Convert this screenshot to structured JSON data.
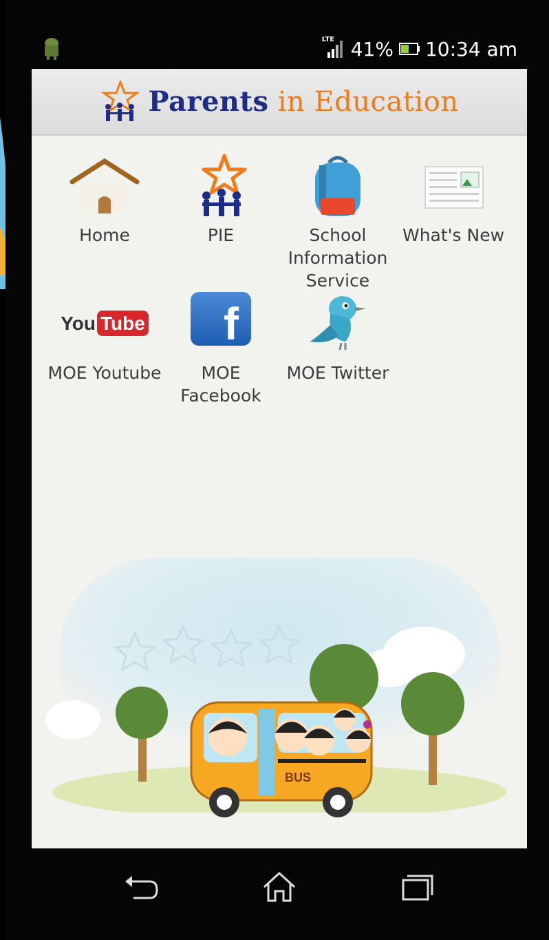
{
  "status_bar": {
    "network": "LTE",
    "battery_percent": "41%",
    "time": "10:34 am"
  },
  "header": {
    "title_main": "Parents",
    "title_rest": " in Education"
  },
  "menu": {
    "items": [
      {
        "label": "Home",
        "icon": "house-icon"
      },
      {
        "label": "PIE",
        "icon": "pie-logo-icon"
      },
      {
        "label": "School Information Service",
        "icon": "school-bag-icon"
      },
      {
        "label": "What's New",
        "icon": "news-icon"
      },
      {
        "label": "MOE Youtube",
        "icon": "youtube-icon"
      },
      {
        "label": "MOE Facebook",
        "icon": "facebook-icon"
      },
      {
        "label": "MOE Twitter",
        "icon": "twitter-bird-icon"
      }
    ],
    "youtube_logo_a": "You",
    "youtube_logo_b": "Tube",
    "facebook_logo": "f"
  },
  "illustration": {
    "bus_label": "BUS"
  },
  "colors": {
    "title_blue": "#1d2c87",
    "title_orange": "#ef7b1a",
    "screen_bg": "#f2f2ef"
  }
}
